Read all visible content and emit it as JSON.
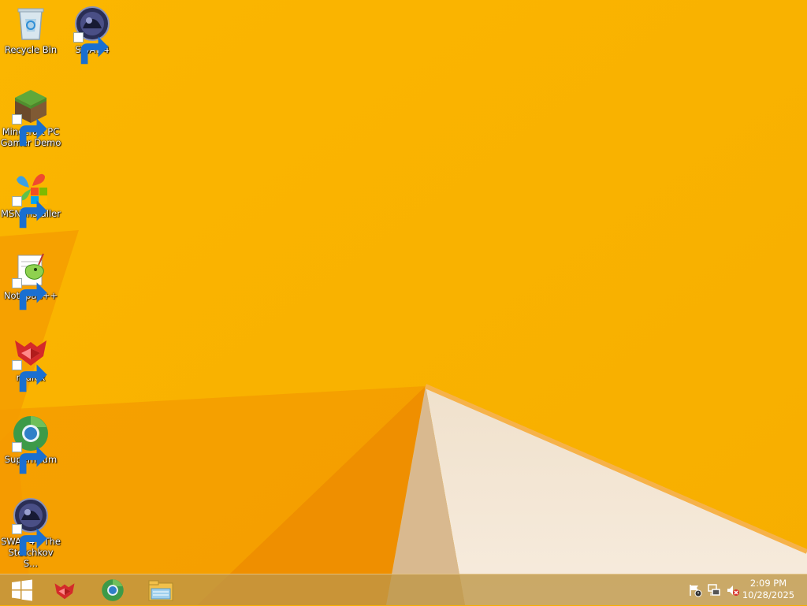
{
  "desktop": {
    "icons": [
      {
        "label": "Recycle Bin",
        "icon": "recycle-bin-icon"
      },
      {
        "label": "SWAT 4",
        "icon": "swat4-icon"
      },
      {
        "label": "Minecraft PC Gamer Demo",
        "icon": "minecraft-icon"
      },
      {
        "label": "MSN Installer",
        "icon": "msn-icon"
      },
      {
        "label": "Notepad++",
        "icon": "notepadpp-icon"
      },
      {
        "label": "r3dfox",
        "icon": "r3dfox-icon"
      },
      {
        "label": "Supermium",
        "icon": "supermium-icon"
      },
      {
        "label": "SWAT 4 - The Stetchkov S...",
        "icon": "swat4-icon"
      }
    ]
  },
  "taskbar": {
    "pinned": [
      {
        "icon": "windows-start-icon"
      },
      {
        "icon": "r3dfox-icon"
      },
      {
        "icon": "supermium-icon"
      },
      {
        "icon": "file-explorer-icon"
      }
    ],
    "tray": {
      "icons": [
        "action-center-flag-icon",
        "network-icon",
        "volume-muted-icon"
      ]
    },
    "clock": {
      "time": "2:09 PM",
      "date": "10/28/2025"
    }
  },
  "colors": {
    "wallpaper_main": "#f8b000",
    "wallpaper_dark": "#f29a00",
    "wallpaper_light": "#f5e6d0",
    "taskbar": "#be9646"
  }
}
